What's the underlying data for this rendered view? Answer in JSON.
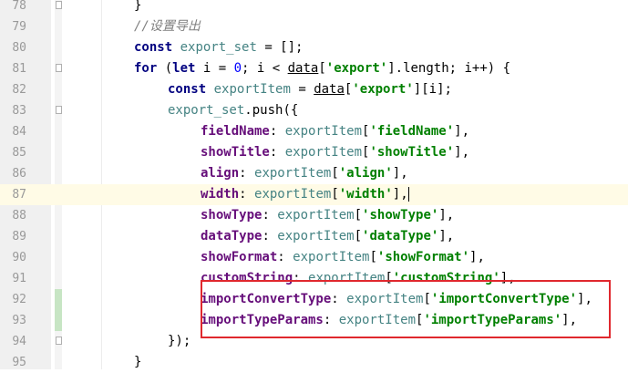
{
  "line_numbers": [
    "78",
    "79",
    "80",
    "81",
    "82",
    "83",
    "84",
    "85",
    "86",
    "87",
    "88",
    "89",
    "90",
    "91",
    "92",
    "93",
    "94",
    "95"
  ],
  "code": {
    "l78": {
      "brace": "}"
    },
    "l79": {
      "comment": "//设置导出"
    },
    "l80": {
      "kw": "const",
      "var": "export_set",
      "rest": " = [];"
    },
    "l81": {
      "kw_for": "for",
      "open": " (",
      "kw_let": "let",
      "mid": " i = ",
      "zero": "0",
      "semi": "; i < ",
      "data": "data",
      "br1": "[",
      "str": "'export'",
      "br2": "].length; i++) {"
    },
    "l82": {
      "kw": "const",
      "var": "exportItem",
      "eq": " = ",
      "data": "data",
      "br1": "[",
      "str": "'export'",
      "br2": "][i];"
    },
    "l83": {
      "var": "export_set",
      "rest": ".push({"
    },
    "props": [
      {
        "prop": "fieldName",
        "var": "exportItem",
        "str": "'fieldName'"
      },
      {
        "prop": "showTitle",
        "var": "exportItem",
        "str": "'showTitle'"
      },
      {
        "prop": "align",
        "var": "exportItem",
        "str": "'align'"
      },
      {
        "prop": "width",
        "var": "exportItem",
        "str": "'width'"
      },
      {
        "prop": "showType",
        "var": "exportItem",
        "str": "'showType'"
      },
      {
        "prop": "dataType",
        "var": "exportItem",
        "str": "'dataType'"
      },
      {
        "prop": "showFormat",
        "var": "exportItem",
        "str": "'showFormat'"
      },
      {
        "prop": "customString",
        "var": "exportItem",
        "str": "'customString'"
      },
      {
        "prop": "importConvertType",
        "var": "exportItem",
        "str": "'importConvertType'"
      },
      {
        "prop": "importTypeParams",
        "var": "exportItem",
        "str": "'importTypeParams'"
      }
    ],
    "l94": {
      "text": "});"
    },
    "l95": {
      "brace": "}"
    }
  },
  "colors": {
    "keyword": "#000080",
    "variable": "#458383",
    "property": "#660e7a",
    "string": "#008000",
    "number": "#0000ff",
    "highlight_box": "#e0282e",
    "change_marker": "#c7e5c4"
  }
}
